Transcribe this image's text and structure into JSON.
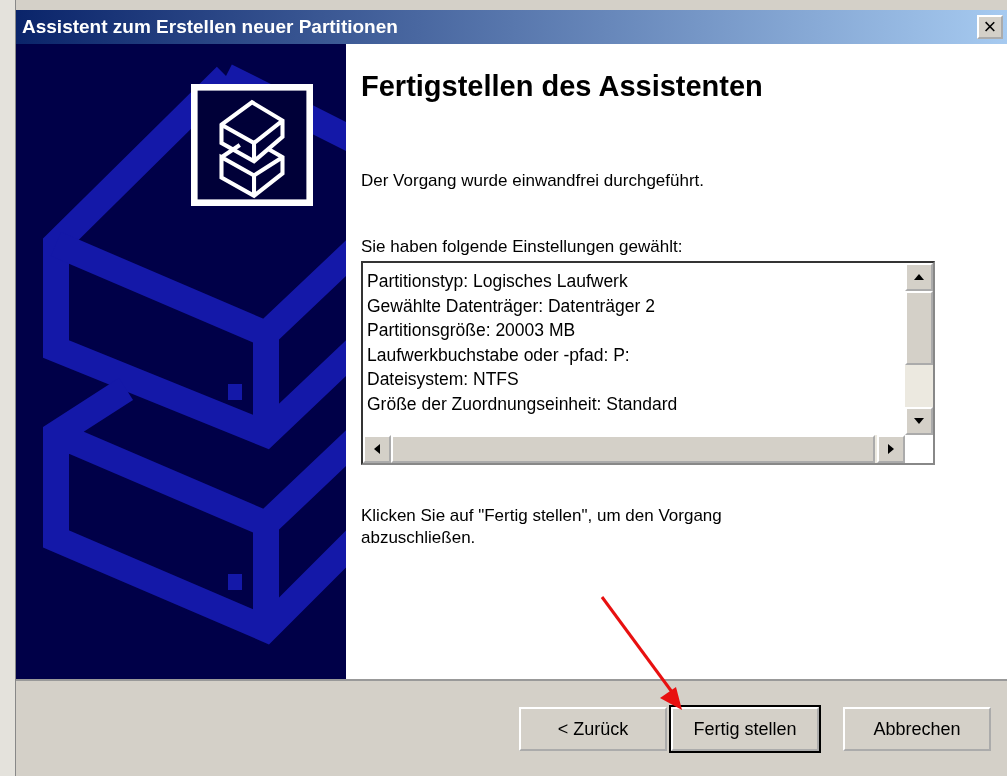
{
  "window": {
    "title": "Assistent zum Erstellen neuer Partitionen",
    "close_glyph": "×"
  },
  "heading": "Fertigstellen des Assistenten",
  "status_text": "Der Vorgang wurde einwandfrei durchgeführt.",
  "summary_label": "Sie haben folgende Einstellungen gewählt:",
  "summary_lines": [
    "Partitionstyp: Logisches Laufwerk",
    "Gewählte Datenträger: Datenträger 2",
    "Partitionsgröße: 20003 MB",
    "Laufwerkbuchstabe oder -pfad: P:",
    "Dateisystem: NTFS",
    "Größe der Zuordnungseinheit: Standard"
  ],
  "instruction": "Klicken Sie auf \"Fertig stellen\", um den Vorgang abzuschließen.",
  "buttons": [
    {
      "label": "< Zurück",
      "default": false
    },
    {
      "label": "Fertig stellen",
      "default": true
    },
    {
      "label": "Abbrechen",
      "default": false
    }
  ]
}
